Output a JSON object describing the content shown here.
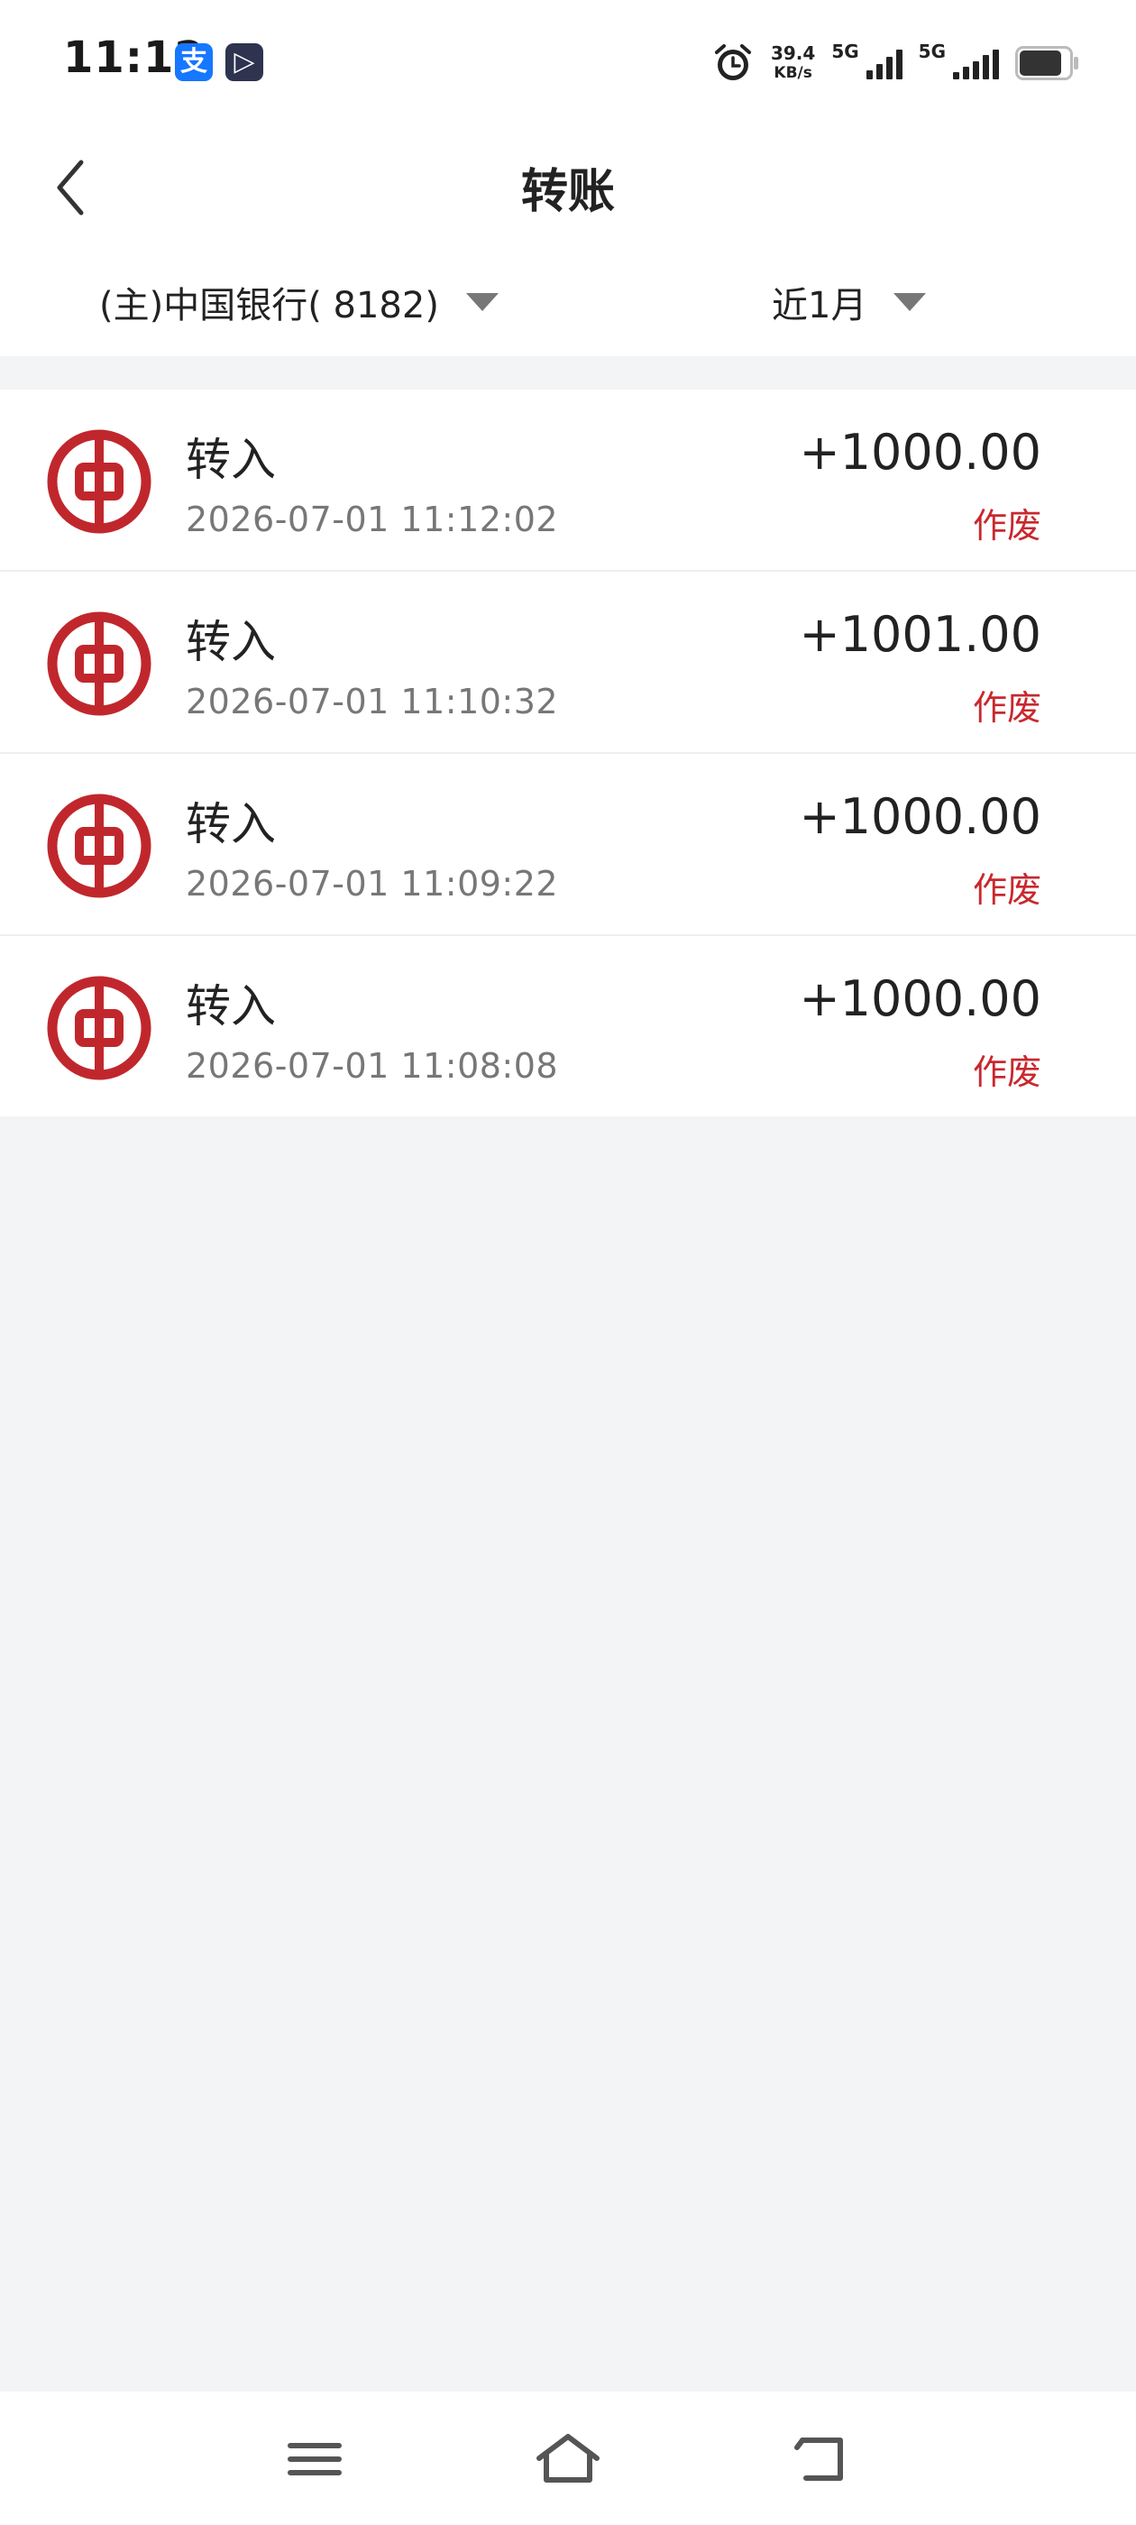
{
  "status_bar": {
    "time": "11:12",
    "alipay_glyph": "支",
    "video_glyph": "▷",
    "net_speed_value": "39.4",
    "net_speed_unit": "KB/s",
    "sim1_label": "5G",
    "sim2_label": "5G",
    "icons": [
      "alarm-icon",
      "signal-icon",
      "battery-icon"
    ]
  },
  "header": {
    "title": "转账",
    "back_icon": "chevron-left-icon"
  },
  "filters": {
    "account": "(主)中国银行( 8182)",
    "range": "近1月",
    "dropdown_icon": "triangle-down-icon"
  },
  "transactions": [
    {
      "type": "转入",
      "datetime": "2026-07-01  11:12:02",
      "amount": "+1000.00",
      "action": "作废"
    },
    {
      "type": "转入",
      "datetime": "2026-07-01  11:10:32",
      "amount": "+1001.00",
      "action": "作废"
    },
    {
      "type": "转入",
      "datetime": "2026-07-01  11:09:22",
      "amount": "+1000.00",
      "action": "作废"
    },
    {
      "type": "转入",
      "datetime": "2026-07-01  11:08:08",
      "amount": "+1000.00",
      "action": "作废"
    }
  ],
  "nav": {
    "icons": [
      "menu-icon",
      "home-icon",
      "back-icon"
    ]
  },
  "colors": {
    "accent_red": "#c8282e",
    "bank_logo_red": "#c0272d",
    "background": "#f3f4f6"
  }
}
